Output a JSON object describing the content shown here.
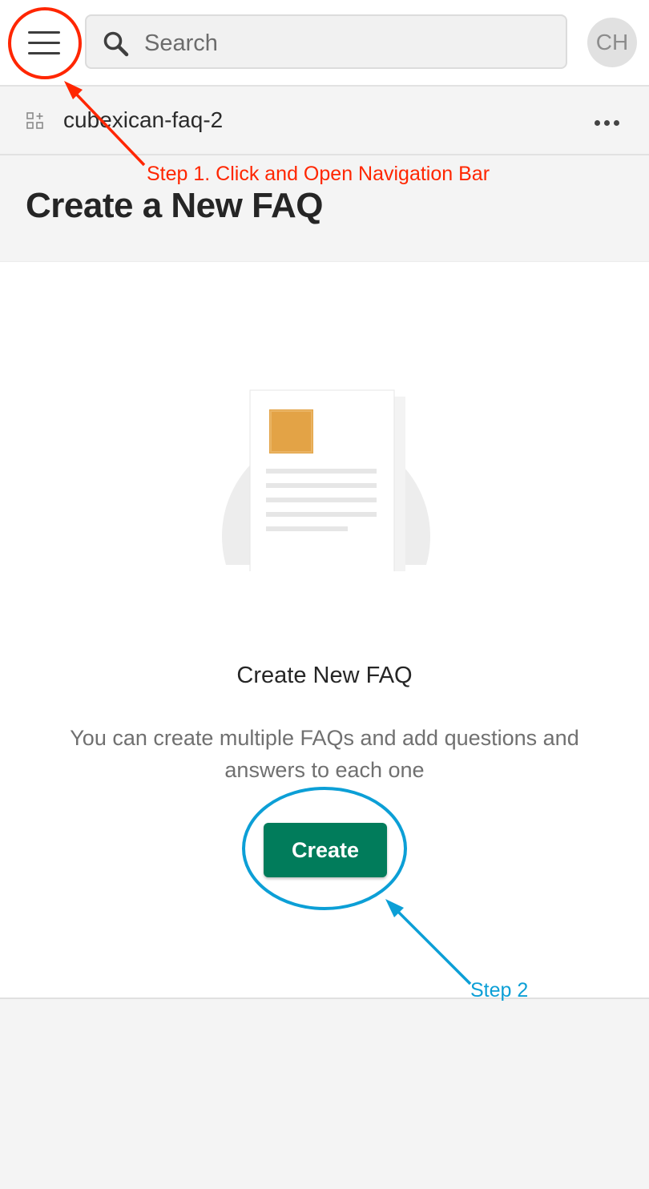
{
  "header": {
    "search_placeholder": "Search",
    "avatar_initials": "CH",
    "menu_icon": "hamburger-menu-icon",
    "search_icon": "search-icon"
  },
  "subheader": {
    "site_name": "cubexican-faq-2",
    "site_icon": "apps-grid-icon",
    "more_icon": "more-horizontal-icon"
  },
  "page": {
    "title": "Create a New FAQ"
  },
  "empty_state": {
    "illustration_icon": "document-illustration-icon",
    "title": "Create New FAQ",
    "description": "You can create multiple FAQs and add questions and answers to each one",
    "create_label": "Create"
  },
  "annotations": {
    "step1": "Step 1. Click and Open Navigation Bar",
    "step2": "Step 2",
    "step1_color": "#ff2600",
    "step2_color": "#0c9fd6"
  },
  "colors": {
    "primary_button": "#017c5b",
    "page_background": "#f4f4f4",
    "panel_background": "#ffffff"
  }
}
